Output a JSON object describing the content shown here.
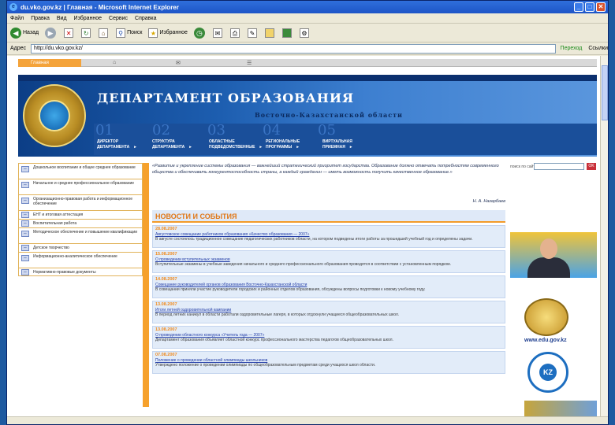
{
  "window": {
    "title": "du.vko.gov.kz | Главная - Microsoft Internet Explorer",
    "minimize": "_",
    "maximize": "□",
    "close": "✕"
  },
  "menubar": [
    "Файл",
    "Правка",
    "Вид",
    "Избранное",
    "Сервис",
    "Справка"
  ],
  "toolbar": {
    "back": "Назад",
    "search": "Поиск",
    "favorites": "Избранное"
  },
  "addressbar": {
    "label": "Адрес",
    "url": "http://du.vko.gov.kz/",
    "go": "Переход",
    "links": "Ссылки"
  },
  "site": {
    "topnav": {
      "home": "Главная",
      "icons": [
        "⌂",
        "✉",
        "☰"
      ]
    },
    "banner": {
      "title": "ДЕПАРТАМЕНТ ОБРАЗОВАНИЯ",
      "region": "Восточно-Казахстанской области",
      "numbers": [
        "01",
        "02",
        "03",
        "04",
        "05"
      ],
      "nav": [
        {
          "line1": "ДИРЕКТОР",
          "line2": "ДЕПАРТАМЕНТА"
        },
        {
          "line1": "СТРУКТУРА",
          "line2": "ДЕПАРТАМЕНТА"
        },
        {
          "line1": "ОБЛАСТНЫЕ",
          "line2": "ПОДВЕДОМСТВЕННЫЕ"
        },
        {
          "line1": "РЕГИОНАЛЬНЫЕ",
          "line2": "ПРОГРАММЫ"
        },
        {
          "line1": "ВИРТУАЛЬНАЯ",
          "line2": "ПРИЕМНАЯ"
        }
      ]
    },
    "left_menu": [
      "Дошкольное воспитание и общее среднее образование",
      "Начальное и среднее профессиональное образование",
      "Организационно-правовая работа и информационное обеспечение",
      "ЕНТ и итоговая аттестация",
      "Воспитательная работа",
      "Методическое обеспечение и повышение квалификации",
      "Детское творчество",
      "Информационно-аналитическое обеспечение",
      "Нормативно-правовые документы"
    ],
    "quote": {
      "text": "«Развитие и укрепление системы образования — важнейший стратегический приоритет государства. Образование должно отвечать потребностям современного общества и обеспечивать конкурентоспособность страны, а каждый гражданин — иметь возможность получить качественное образование.»",
      "author": "Н. А. Назарбаев"
    },
    "news": {
      "header": "НОВОСТИ И СОБЫТИЯ",
      "items": [
        {
          "date": "28.08.2007",
          "title": "Августовское совещание работников образования «Качество образования — 2007»",
          "body": "В августе состоялось традиционное совещание педагогических работников области, на котором подведены итоги работы за прошедший учебный год и определены задачи."
        },
        {
          "date": "15.08.2007",
          "title": "О проведении вступительных экзаменов",
          "body": "Вступительные экзамены в учебные заведения начального и среднего профессионального образования проводятся в соответствии с установленным порядком."
        },
        {
          "date": "14.08.2007",
          "title": "Совещание руководителей органов образования Восточно-Казахстанской области",
          "body": "В совещании приняли участие руководители городских и районных отделов образования, обсуждены вопросы подготовки к новому учебному году."
        },
        {
          "date": "13.08.2007",
          "title": "Итоги летней оздоровительной кампании",
          "body": "В период летних каникул в области работали оздоровительные лагеря, в которых отдохнули учащиеся общеобразовательных школ."
        },
        {
          "date": "13.08.2007",
          "title": "О проведении областного конкурса «Учитель года — 2007»",
          "body": "Департамент образования объявляет областной конкурс профессионального мастерства педагогов общеобразовательных школ."
        },
        {
          "date": "07.08.2007",
          "title": "Положение о проведении областной олимпиады школьников",
          "body": "Утверждено положение о проведении олимпиады по общеобразовательным предметам среди учащихся школ области."
        }
      ]
    },
    "right": {
      "search_label": "поиск по сайту",
      "search_go": "OK",
      "edu_caption": "www.edu.gov.kz",
      "kz_logo": "KZ"
    }
  }
}
